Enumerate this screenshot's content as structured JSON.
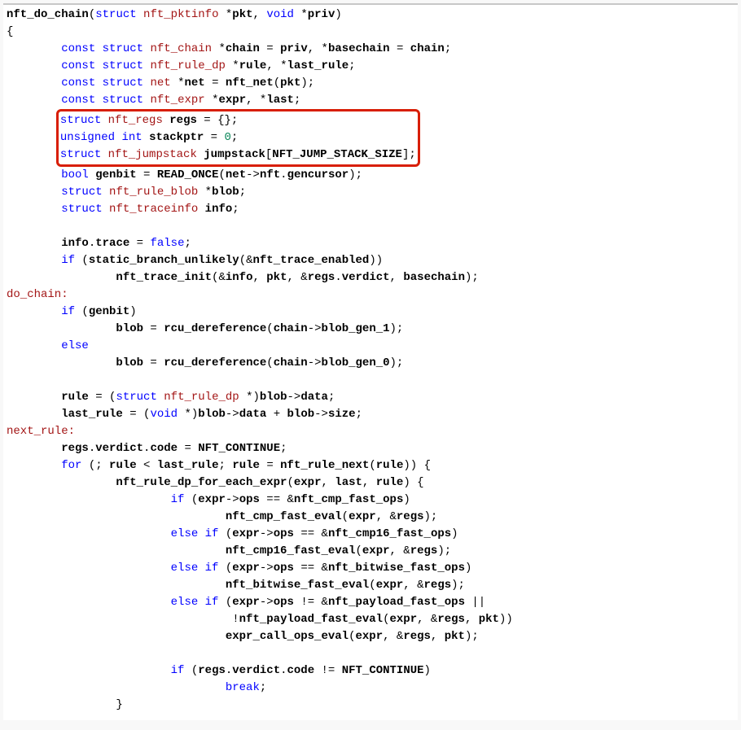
{
  "code": {
    "l01_fn": "nft_do_chain",
    "l01_a": "(",
    "l01_struct": "struct",
    "l01_type1": " nft_pktinfo",
    "l01_b": " *",
    "l01_p1": "pkt",
    "l01_c": ", ",
    "l01_void": "void",
    "l01_d": " *",
    "l01_p2": "priv",
    "l01_e": ")",
    "l02": "{",
    "l03_pre": "        ",
    "l03_const": "const",
    "l03_sp1": " ",
    "l03_struct": "struct",
    "l03_type": " nft_chain",
    "l03_a": " *",
    "l03_v1": "chain",
    "l03_b": " = ",
    "l03_v2": "priv",
    "l03_c": ", *",
    "l03_v3": "basechain",
    "l03_d": " = ",
    "l03_v4": "chain",
    "l03_e": ";",
    "l04_pre": "        ",
    "l04_const": "const",
    "l04_sp1": " ",
    "l04_struct": "struct",
    "l04_type": " nft_rule_dp",
    "l04_a": " *",
    "l04_v1": "rule",
    "l04_b": ", *",
    "l04_v2": "last_rule",
    "l04_c": ";",
    "l05_pre": "        ",
    "l05_const": "const",
    "l05_sp1": " ",
    "l05_struct": "struct",
    "l05_type": " net",
    "l05_a": " *",
    "l05_v1": "net",
    "l05_b": " = ",
    "l05_fn": "nft_net",
    "l05_c": "(",
    "l05_v2": "pkt",
    "l05_d": ");",
    "l06_pre": "        ",
    "l06_const": "const",
    "l06_sp1": " ",
    "l06_struct": "struct",
    "l06_type": " nft_expr",
    "l06_a": " *",
    "l06_v1": "expr",
    "l06_b": ", *",
    "l06_v2": "last",
    "l06_c": ";",
    "hb_pre": "       ",
    "l07_struct": "struct",
    "l07_type": " nft_regs",
    "l07_sp": " ",
    "l07_v1": "regs",
    "l07_a": " = {};",
    "l08_unsigned": "unsigned",
    "l08_sp1": " ",
    "l08_int": "int",
    "l08_sp2": " ",
    "l08_v1": "stackptr",
    "l08_a": " = ",
    "l08_lit": "0",
    "l08_b": ";",
    "l09_struct": "struct",
    "l09_type": " nft_jumpstack",
    "l09_sp": " ",
    "l09_v1": "jumpstack",
    "l09_a": "[",
    "l09_c1": "NFT_JUMP_STACK_SIZE",
    "l09_b": "];",
    "l10_pre": "        ",
    "l10_bool": "bool",
    "l10_sp": " ",
    "l10_v1": "genbit",
    "l10_a": " = ",
    "l10_fn": "READ_ONCE",
    "l10_b": "(",
    "l10_v2": "net",
    "l10_c": "->",
    "l10_v3": "nft",
    "l10_d": ".",
    "l10_v4": "gencursor",
    "l10_e": ");",
    "l11_pre": "        ",
    "l11_struct": "struct",
    "l11_type": " nft_rule_blob",
    "l11_a": " *",
    "l11_v1": "blob",
    "l11_b": ";",
    "l12_pre": "        ",
    "l12_struct": "struct",
    "l12_type": " nft_traceinfo",
    "l12_sp": " ",
    "l12_v1": "info",
    "l12_a": ";",
    "l13": " ",
    "l14_pre": "        ",
    "l14_v1": "info",
    "l14_a": ".",
    "l14_v2": "trace",
    "l14_b": " = ",
    "l14_false": "false",
    "l14_c": ";",
    "l15_pre": "        ",
    "l15_if": "if",
    "l15_a": " (",
    "l15_fn": "static_branch_unlikely",
    "l15_b": "(&",
    "l15_v1": "nft_trace_enabled",
    "l15_c": "))",
    "l16_pre": "                ",
    "l16_fn": "nft_trace_init",
    "l16_a": "(&",
    "l16_v1": "info",
    "l16_b": ", ",
    "l16_v2": "pkt",
    "l16_c": ", &",
    "l16_v3": "regs",
    "l16_d": ".",
    "l16_v4": "verdict",
    "l16_e": ", ",
    "l16_v5": "basechain",
    "l16_f": ");",
    "l17": "do_chain:",
    "l18_pre": "        ",
    "l18_if": "if",
    "l18_a": " (",
    "l18_v1": "genbit",
    "l18_b": ")",
    "l19_pre": "                ",
    "l19_v1": "blob",
    "l19_a": " = ",
    "l19_fn": "rcu_dereference",
    "l19_b": "(",
    "l19_v2": "chain",
    "l19_c": "->",
    "l19_v3": "blob_gen_1",
    "l19_d": ");",
    "l20_pre": "        ",
    "l20_else": "else",
    "l21_pre": "                ",
    "l21_v1": "blob",
    "l21_a": " = ",
    "l21_fn": "rcu_dereference",
    "l21_b": "(",
    "l21_v2": "chain",
    "l21_c": "->",
    "l21_v3": "blob_gen_0",
    "l21_d": ");",
    "l22": " ",
    "l23_pre": "        ",
    "l23_v1": "rule",
    "l23_a": " = (",
    "l23_struct": "struct",
    "l23_type": " nft_rule_dp",
    "l23_b": " *)",
    "l23_v2": "blob",
    "l23_c": "->",
    "l23_v3": "data",
    "l23_d": ";",
    "l24_pre": "        ",
    "l24_v1": "last_rule",
    "l24_a": " = (",
    "l24_void": "void",
    "l24_b": " *)",
    "l24_v2": "blob",
    "l24_c": "->",
    "l24_v3": "data",
    "l24_d": " + ",
    "l24_v4": "blob",
    "l24_e": "->",
    "l24_v5": "size",
    "l24_f": ";",
    "l25": "next_rule:",
    "l26_pre": "        ",
    "l26_v1": "regs",
    "l26_a": ".",
    "l26_v2": "verdict",
    "l26_b": ".",
    "l26_v3": "code",
    "l26_c": " = ",
    "l26_c1": "NFT_CONTINUE",
    "l26_d": ";",
    "l27_pre": "        ",
    "l27_for": "for",
    "l27_a": " (; ",
    "l27_v1": "rule",
    "l27_b": " < ",
    "l27_v2": "last_rule",
    "l27_c": "; ",
    "l27_v3": "rule",
    "l27_d": " = ",
    "l27_fn": "nft_rule_next",
    "l27_e": "(",
    "l27_v4": "rule",
    "l27_f": ")) {",
    "l28_pre": "                ",
    "l28_fn": "nft_rule_dp_for_each_expr",
    "l28_a": "(",
    "l28_v1": "expr",
    "l28_b": ", ",
    "l28_v2": "last",
    "l28_c": ", ",
    "l28_v3": "rule",
    "l28_d": ") {",
    "l29_pre": "                        ",
    "l29_if": "if",
    "l29_a": " (",
    "l29_v1": "expr",
    "l29_b": "->",
    "l29_v2": "ops",
    "l29_c": " == &",
    "l29_v3": "nft_cmp_fast_ops",
    "l29_d": ")",
    "l30_pre": "                                ",
    "l30_fn": "nft_cmp_fast_eval",
    "l30_a": "(",
    "l30_v1": "expr",
    "l30_b": ", &",
    "l30_v2": "regs",
    "l30_c": ");",
    "l31_pre": "                        ",
    "l31_else": "else",
    "l31_sp": " ",
    "l31_if": "if",
    "l31_a": " (",
    "l31_v1": "expr",
    "l31_b": "->",
    "l31_v2": "ops",
    "l31_c": " == &",
    "l31_v3": "nft_cmp16_fast_ops",
    "l31_d": ")",
    "l32_pre": "                                ",
    "l32_fn": "nft_cmp16_fast_eval",
    "l32_a": "(",
    "l32_v1": "expr",
    "l32_b": ", &",
    "l32_v2": "regs",
    "l32_c": ");",
    "l33_pre": "                        ",
    "l33_else": "else",
    "l33_sp": " ",
    "l33_if": "if",
    "l33_a": " (",
    "l33_v1": "expr",
    "l33_b": "->",
    "l33_v2": "ops",
    "l33_c": " == &",
    "l33_v3": "nft_bitwise_fast_ops",
    "l33_d": ")",
    "l34_pre": "                                ",
    "l34_fn": "nft_bitwise_fast_eval",
    "l34_a": "(",
    "l34_v1": "expr",
    "l34_b": ", &",
    "l34_v2": "regs",
    "l34_c": ");",
    "l35_pre": "                        ",
    "l35_else": "else",
    "l35_sp": " ",
    "l35_if": "if",
    "l35_a": " (",
    "l35_v1": "expr",
    "l35_b": "->",
    "l35_v2": "ops",
    "l35_c": " != &",
    "l35_v3": "nft_payload_fast_ops",
    "l35_d": " ||",
    "l36_pre": "                                 !",
    "l36_fn": "nft_payload_fast_eval",
    "l36_a": "(",
    "l36_v1": "expr",
    "l36_b": ", &",
    "l36_v2": "regs",
    "l36_c": ", ",
    "l36_v3": "pkt",
    "l36_d": "))",
    "l37_pre": "                                ",
    "l37_fn": "expr_call_ops_eval",
    "l37_a": "(",
    "l37_v1": "expr",
    "l37_b": ", &",
    "l37_v2": "regs",
    "l37_c": ", ",
    "l37_v3": "pkt",
    "l37_d": ");",
    "l38": " ",
    "l39_pre": "                        ",
    "l39_if": "if",
    "l39_a": " (",
    "l39_v1": "regs",
    "l39_b": ".",
    "l39_v2": "verdict",
    "l39_c": ".",
    "l39_v3": "code",
    "l39_d": " != ",
    "l39_c1": "NFT_CONTINUE",
    "l39_e": ")",
    "l40_pre": "                                ",
    "l40_break": "break",
    "l40_a": ";",
    "l41_pre": "                }",
    "l41": "}"
  }
}
